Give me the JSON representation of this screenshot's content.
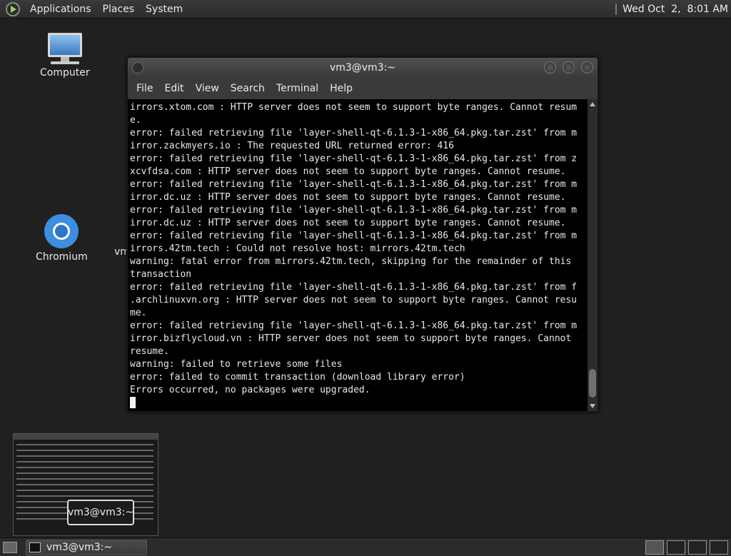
{
  "top_panel": {
    "menu": [
      "Applications",
      "Places",
      "System"
    ],
    "clock": "Wed Oct  2,  8:01 AM"
  },
  "desktop": {
    "icons": {
      "computer": "Computer",
      "chromium": "Chromium",
      "partial": "vm"
    }
  },
  "window": {
    "title": "vm3@vm3:~",
    "menu": [
      "File",
      "Edit",
      "View",
      "Search",
      "Terminal",
      "Help"
    ],
    "terminal_lines": [
      "irrors.xtom.com : HTTP server does not seem to support byte ranges. Cannot resum",
      "e.",
      "error: failed retrieving file 'layer-shell-qt-6.1.3-1-x86_64.pkg.tar.zst' from m",
      "irror.zackmyers.io : The requested URL returned error: 416",
      "error: failed retrieving file 'layer-shell-qt-6.1.3-1-x86_64.pkg.tar.zst' from z",
      "xcvfdsa.com : HTTP server does not seem to support byte ranges. Cannot resume.",
      "error: failed retrieving file 'layer-shell-qt-6.1.3-1-x86_64.pkg.tar.zst' from m",
      "irror.dc.uz : HTTP server does not seem to support byte ranges. Cannot resume.",
      "error: failed retrieving file 'layer-shell-qt-6.1.3-1-x86_64.pkg.tar.zst' from m",
      "irror.dc.uz : HTTP server does not seem to support byte ranges. Cannot resume.",
      "error: failed retrieving file 'layer-shell-qt-6.1.3-1-x86_64.pkg.tar.zst' from m",
      "irrors.42tm.tech : Could not resolve host: mirrors.42tm.tech",
      "warning: fatal error from mirrors.42tm.tech, skipping for the remainder of this",
      "transaction",
      "error: failed retrieving file 'layer-shell-qt-6.1.3-1-x86_64.pkg.tar.zst' from f",
      ".archlinuxvn.org : HTTP server does not seem to support byte ranges. Cannot resu",
      "me.",
      "error: failed retrieving file 'layer-shell-qt-6.1.3-1-x86_64.pkg.tar.zst' from m",
      "irror.bizflycloud.vn : HTTP server does not seem to support byte ranges. Cannot",
      "resume.",
      "warning: failed to retrieve some files",
      "error: failed to commit transaction (download library error)",
      "Errors occurred, no packages were upgraded."
    ]
  },
  "tooltip": "vm3@vm3:~",
  "bottom_panel": {
    "task_label": "vm3@vm3:~"
  }
}
